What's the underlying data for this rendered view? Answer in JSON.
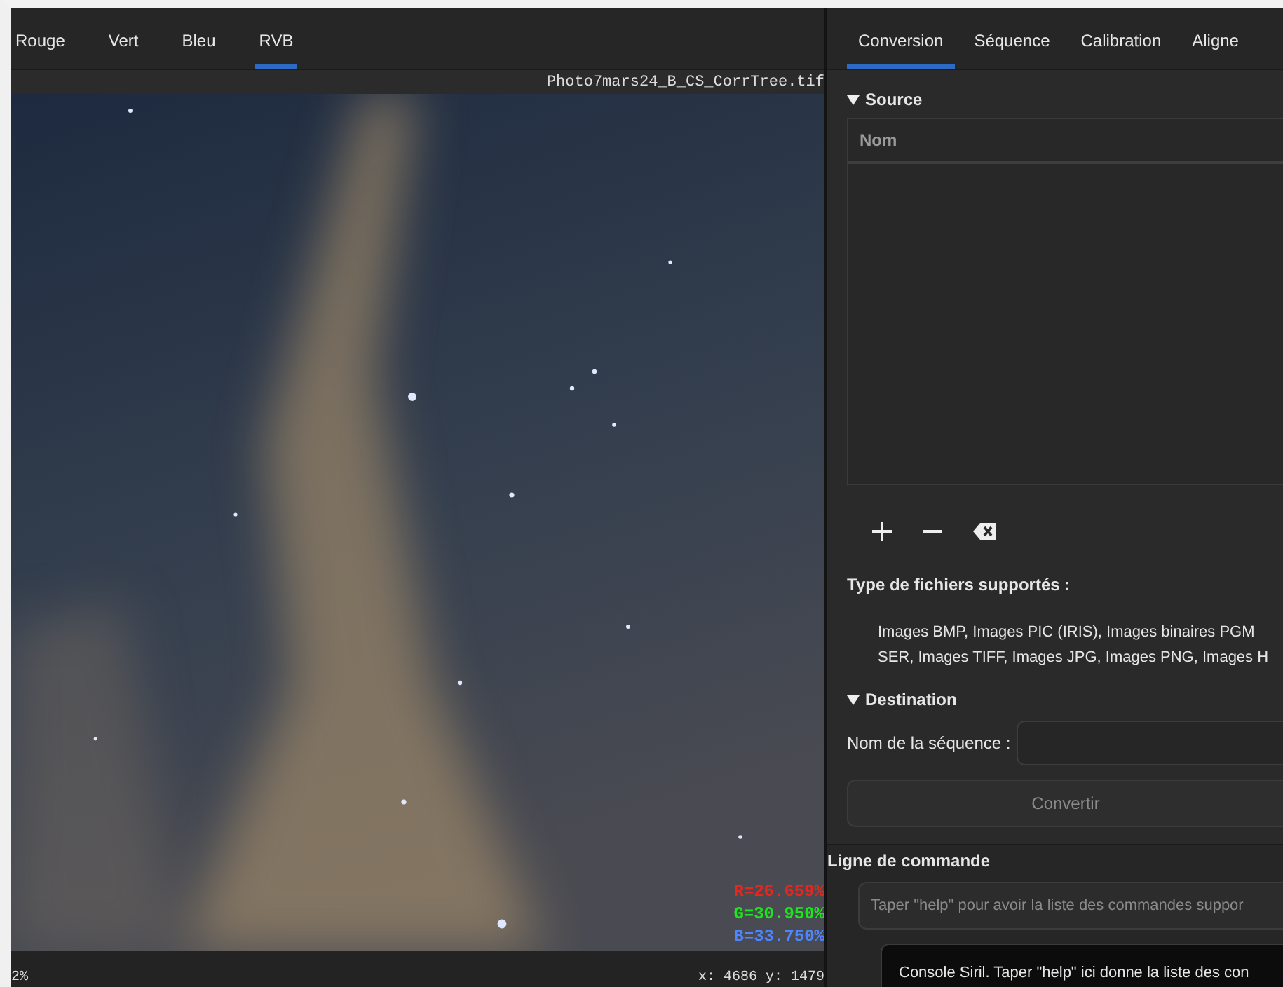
{
  "image_tabs": [
    {
      "label": "Rouge",
      "selected": false
    },
    {
      "label": "Vert",
      "selected": false
    },
    {
      "label": "Bleu",
      "selected": false
    },
    {
      "label": "RVB",
      "selected": true
    }
  ],
  "filename": "Photo7mars24_B_CS_CorrTree.tif",
  "rgb_readout": [
    {
      "text": "R=26.659%",
      "color": "#e8261e"
    },
    {
      "text": "G=30.950%",
      "color": "#1ee61e"
    },
    {
      "text": "B=33.750%",
      "color": "#4d86ff"
    }
  ],
  "zoom": "2%",
  "coordinates": "x: 4686 y: 1479",
  "panel_tabs": [
    {
      "label": "Conversion",
      "selected": true
    },
    {
      "label": "Séquence",
      "selected": false
    },
    {
      "label": "Calibration",
      "selected": false
    },
    {
      "label": "Aligne",
      "selected": false
    }
  ],
  "source": {
    "title": "Source",
    "expanded": true,
    "columns": [
      "Nom"
    ]
  },
  "supported_types": {
    "label": "Type de fichiers supportés :",
    "lines": [
      "Images BMP, Images PIC (IRIS), Images binaires PGM",
      "SER, Images TIFF, Images JPG, Images PNG, Images H"
    ]
  },
  "destination": {
    "title": "Destination",
    "expanded": true,
    "sequence_label": "Nom de la séquence :"
  },
  "convert_button": {
    "label": "Convertir",
    "disabled": true
  },
  "command_line": {
    "title": "Ligne de commande",
    "placeholder": "Taper \"help\" pour avoir la liste des commandes suppor"
  },
  "tooltip": "Console Siril. Taper \"help\" ici donne la liste des con"
}
